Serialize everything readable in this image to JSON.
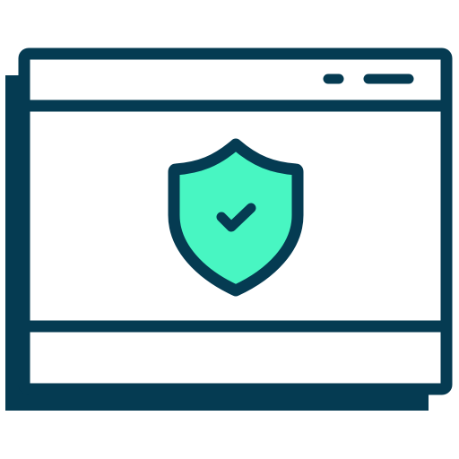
{
  "icon": {
    "name": "secure-browser-window-icon",
    "parts": [
      "browser-window-icon",
      "shield-icon",
      "checkmark-icon"
    ]
  },
  "colors": {
    "outline": "#053b52",
    "shield_fill": "#48f6c2",
    "window_fill": "#ffffff",
    "background": "#ffffff"
  }
}
